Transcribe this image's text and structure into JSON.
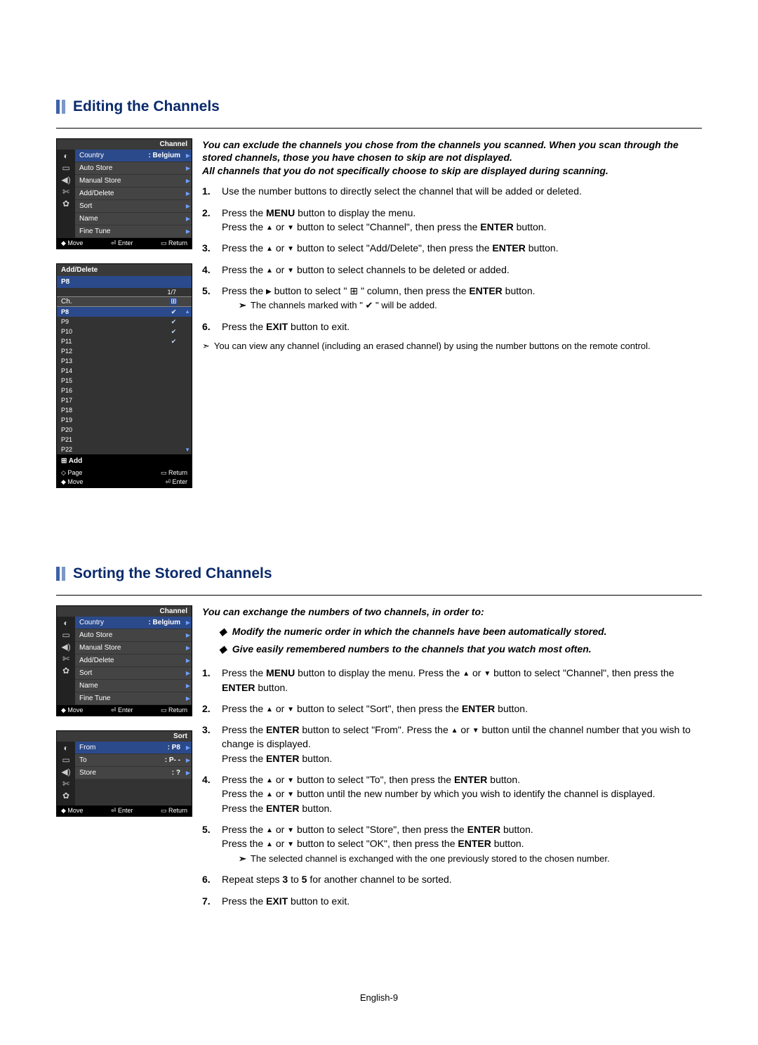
{
  "page_footer": "English-9",
  "section1": {
    "title": "Editing the Channels",
    "intro": "You can exclude the channels you chose from the channels you scanned.   When you scan through the stored channels, those you have chosen to skip are not displayed.\nAll channels that you do not specifically choose to skip are displayed during scanning.",
    "step1": "Use the number buttons to directly select the channel that will be added or deleted.",
    "step2a": "Press the ",
    "step2b": " button to display the menu.",
    "step2c": "Press the ",
    "step2d": " button to select \"Channel\", then press the ",
    "step2e": " button.",
    "step3a": "Press the ",
    "step3b": " button to select \"Add/Delete\", then press the ",
    "step3c": " button.",
    "step4a": "Press the ",
    "step4b": " button to select channels to be deleted or added.",
    "step5a": "Press the ",
    "step5b": " button to select \" ",
    "step5c": " \" column, then press the ",
    "step5d": " button.",
    "step5note": "The channels marked with \" ",
    "step5note2": " \" will be added.",
    "step6a": "Press the ",
    "step6b": " button to exit.",
    "footnote": "You can view any channel (including an erased channel) by using the number buttons on the remote control.",
    "MENU": "MENU",
    "ENTER": "ENTER",
    "EXIT": "EXIT",
    "or": " or ",
    "osd": {
      "title": "Channel",
      "rows": [
        {
          "label": "Country",
          "val": ": Belgium"
        },
        {
          "label": "Auto Store",
          "val": ""
        },
        {
          "label": "Manual Store",
          "val": ""
        },
        {
          "label": "Add/Delete",
          "val": ""
        },
        {
          "label": "Sort",
          "val": ""
        },
        {
          "label": "Name",
          "val": ""
        },
        {
          "label": "Fine Tune",
          "val": ""
        }
      ],
      "foot_move": "Move",
      "foot_enter": "Enter",
      "foot_return": "Return"
    },
    "osd2": {
      "title": "Add/Delete",
      "selected": "P8",
      "page": "1/7",
      "col": "Ch.",
      "rows": [
        "P8",
        "P9",
        "P10",
        "P11",
        "P12",
        "P13",
        "P14",
        "P15",
        "P16",
        "P17",
        "P18",
        "P19",
        "P20",
        "P21",
        "P22"
      ],
      "checks": [
        true,
        true,
        true,
        true,
        false,
        false,
        false,
        false,
        false,
        false,
        false,
        false,
        false,
        false,
        false
      ],
      "add": "Add",
      "foot_page": "Page",
      "foot_return": "Return",
      "foot_move": "Move",
      "foot_enter": "Enter"
    }
  },
  "section2": {
    "title": "Sorting the Stored Channels",
    "intro": "You can exchange the numbers of two channels, in order to:",
    "d1": "Modify the numeric order in which the channels have been automatically stored.",
    "d2": "Give easily remembered numbers to the channels that you watch most often.",
    "step1a": "Press the ",
    "step1b": " button to display the menu. Press the ",
    "step1c": " button to select \"Channel\", then press the ",
    "step1d": " button.",
    "step2a": "Press the ",
    "step2b": " button to select \"Sort\", then press the ",
    "step2c": " button.",
    "step3a": "Press the ",
    "step3b": " button to select \"From\". Press the ",
    "step3c": " button until the channel number that you wish to change is displayed.",
    "step3d": "Press the ",
    "step3e": " button.",
    "step4a": "Press the ",
    "step4b": " button to select \"To\", then press the ",
    "step4c": " button.",
    "step4d": "Press the ",
    "step4e": " button until the new number by which you wish to identify the channel is displayed.",
    "step4f": "Press the ",
    "step4g": " button.",
    "step5a": "Press the ",
    "step5b": " button to select \"Store\", then press the ",
    "step5c": " button.",
    "step5d": "Press the ",
    "step5e": " button to select \"OK\", then press the ",
    "step5f": " button.",
    "step5note": "The selected channel is exchanged with the one previously stored to the chosen number.",
    "step6a": "Repeat steps ",
    "step6b": " for another channel to be sorted.",
    "step7a": "Press the ",
    "step7b": " button to exit.",
    "three": "3",
    "to": " to ",
    "five": "5",
    "osd_sort": {
      "title": "Sort",
      "rows": [
        {
          "label": "From",
          "val": ": P8"
        },
        {
          "label": "To",
          "val": ": P- -"
        },
        {
          "label": "Store",
          "val": ": ?"
        }
      ]
    }
  }
}
